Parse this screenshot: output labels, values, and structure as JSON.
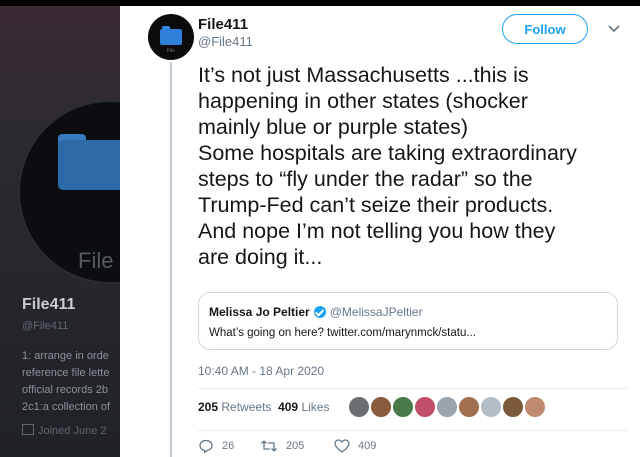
{
  "background_profile": {
    "avatar_label": "File",
    "name": "File411",
    "handle": "@File411",
    "bio_lines": [
      "1: arrange in orde",
      "reference file lette",
      "official records 2b",
      "2c1:a collection of"
    ],
    "joined": "Joined June 2"
  },
  "tweet": {
    "author_name": "File411",
    "author_handle": "@File411",
    "avatar_label": "File",
    "follow_label": "Follow",
    "text_lines": [
      "It’s not just Massachusetts ...this is",
      "happening in other states (shocker",
      "mainly blue or purple states)",
      "Some hospitals are taking extraordinary",
      "steps to “fly under the radar” so the",
      "Trump-Fed can’t seize their products.",
      "And nope I’m not telling you how they",
      "are doing it..."
    ],
    "quote": {
      "name": "Melissa Jo Peltier",
      "handle": "@MelissaJPeltier",
      "text": "What’s going on here? twitter.com/marynmck/statu..."
    },
    "timestamp": "10:40 AM - 18 Apr 2020",
    "retweets_count": "205",
    "retweets_label": "Retweets",
    "likes_count": "409",
    "likes_label": "Likes",
    "liker_colors": [
      "#6b6f74",
      "#8a5a3c",
      "#4a7a4a",
      "#c2506a",
      "#9aa4ad",
      "#a07050",
      "#b4bcc4",
      "#7a5a3a",
      "#c08a70"
    ],
    "actions": {
      "reply_count": "26",
      "retweet_count": "205",
      "like_count": "409"
    }
  },
  "colors": {
    "accent": "#1da1f2",
    "text_primary": "#14171a",
    "text_secondary": "#657786"
  }
}
